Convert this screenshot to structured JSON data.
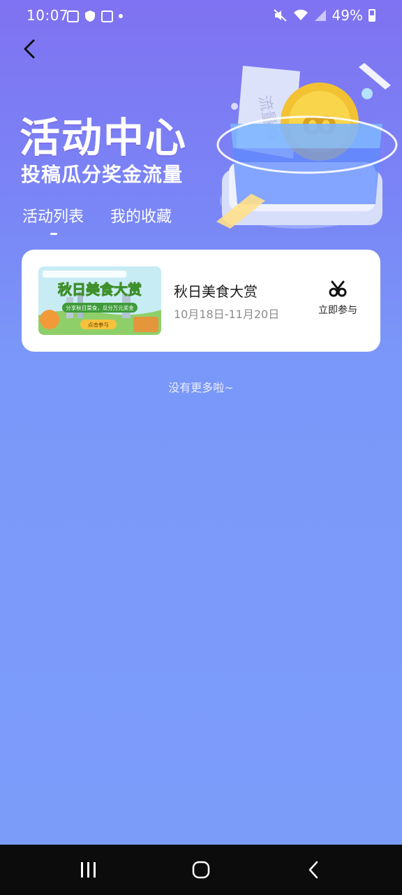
{
  "status_bar": {
    "time": "10:07",
    "battery": "49%"
  },
  "page": {
    "title": "活动中心",
    "subtitle": "投稿瓜分奖金流量"
  },
  "hero": {
    "ticket_text": "流量券"
  },
  "tabs": [
    {
      "label": "活动列表",
      "active": true
    },
    {
      "label": "我的收藏",
      "active": false
    }
  ],
  "activities": [
    {
      "name": "秋日美食大赏",
      "dates": "10月18日-11月20日",
      "action_label": "立即参与",
      "banner": {
        "title": "秋日美食大赏",
        "tagline": "分享秋日菜食，瓜分万元奖金",
        "button": "点击参与"
      }
    }
  ],
  "footer_text": "没有更多啦~",
  "colors": {
    "accent": "#7a98f9",
    "title_text": "#ffffff",
    "nav_bar": "#0c0c0c"
  }
}
